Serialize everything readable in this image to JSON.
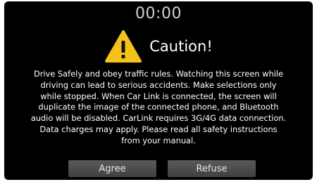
{
  "clock": {
    "time": "00:00"
  },
  "dialog": {
    "title": "Caution!",
    "icon": "warning-icon",
    "message": "Drive Safely and obey traffic rules. Watching this screen while\ndriving can lead to serious accidents. Make selections only\nwhile stopped. When Car Link is connected, the screen will\nduplicate the image of the connected phone, and Bluetooth\naudio will be disabled. CarLink requires 3G/4G data connection.\nData charges may apply. Please read all safety instructions\nfrom your manual."
  },
  "buttons": {
    "agree_label": "Agree",
    "refuse_label": "Refuse"
  },
  "colors": {
    "background": "#000000",
    "warning_yellow": "#f4c21a",
    "button_gray": "#4d4d4d"
  }
}
